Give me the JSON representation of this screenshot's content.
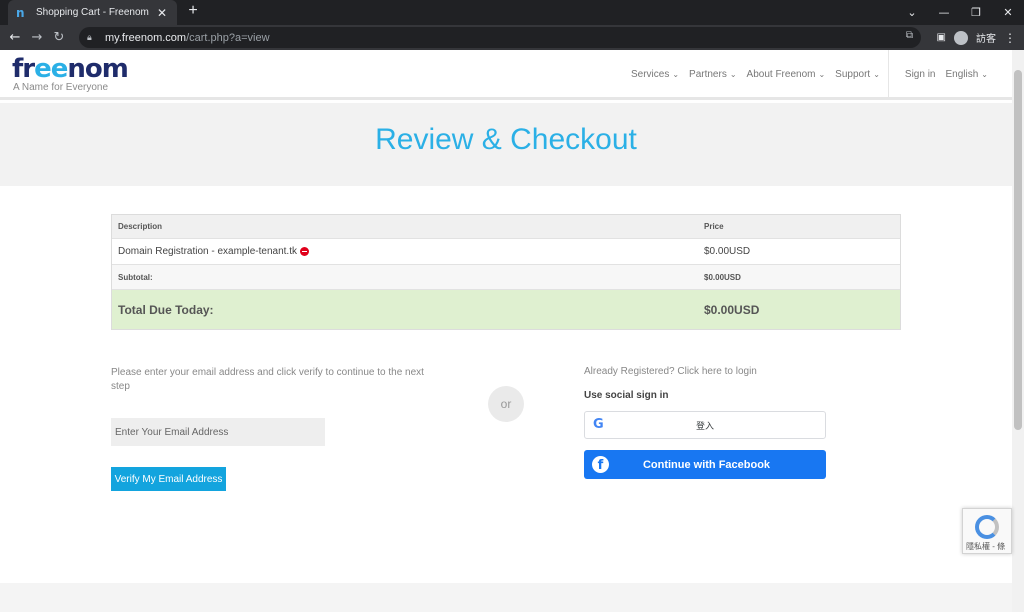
{
  "browser": {
    "tab_title": "Shopping Cart - Freenom",
    "tab_favicon": "n",
    "url_host": "my.freenom.com",
    "url_path": "/cart.php?a=view",
    "profile_label": "訪客"
  },
  "header": {
    "logo_prefix": "fr",
    "logo_ee": "ee",
    "logo_suffix": "nom",
    "tagline": "A Name for Everyone",
    "nav": {
      "services": "Services",
      "partners": "Partners",
      "about": "About Freenom",
      "support": "Support",
      "signin": "Sign in",
      "language": "English"
    }
  },
  "hero": {
    "title": "Review & Checkout"
  },
  "cart": {
    "columns": {
      "description": "Description",
      "price": "Price"
    },
    "items": [
      {
        "description": "Domain Registration - example-tenant.tk",
        "price": "$0.00USD"
      }
    ],
    "subtotal_label": "Subtotal:",
    "subtotal_value": "$0.00USD",
    "total_label": "Total Due Today:",
    "total_value": "$0.00USD"
  },
  "verify": {
    "instructions": "Please enter your email address and click verify to continue to the next step",
    "email_placeholder": "Enter Your Email Address",
    "button": "Verify My Email Address"
  },
  "divider": {
    "or": "or"
  },
  "login": {
    "already": "Already Registered? Click here to login",
    "social_label": "Use social sign in",
    "google_button": "登入",
    "facebook_button": "Continue with Facebook"
  },
  "recaptcha": {
    "text": "隱私權 - 條"
  },
  "colors": {
    "accent": "#2bb0e6",
    "verify_button": "#13a4de",
    "facebook": "#1877f2",
    "total_row": "#dff0d0",
    "logo_dark": "#1f2c6b"
  }
}
